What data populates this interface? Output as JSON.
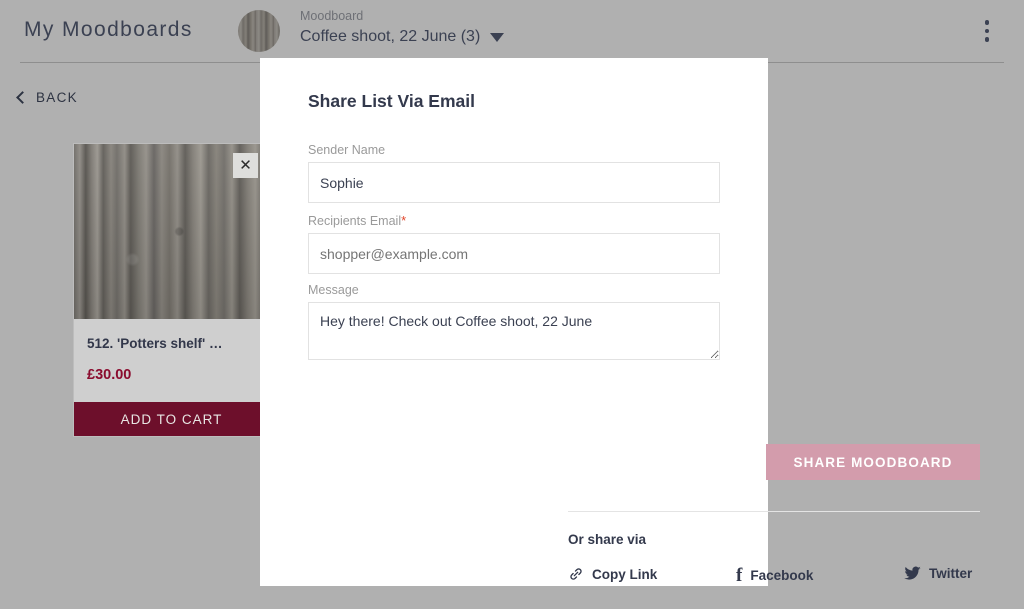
{
  "header": {
    "app_title": "My Moodboards",
    "moodboard_label": "Moodboard",
    "moodboard_name": "Coffee shoot, 22 June (3)",
    "avatar_icon": "moodboard-thumbnail",
    "caret_icon": "chevron-down-icon",
    "menu_icon": "kebab-menu-icon"
  },
  "nav": {
    "back_label": "BACK",
    "back_icon": "chevron-left-icon"
  },
  "card": {
    "title": "512. 'Potters shelf' …",
    "price": "£30.00",
    "cta_label": "ADD TO CART",
    "close_icon": "close-icon",
    "close_glyph": "✕",
    "image_alt": "wooden-planks-texture"
  },
  "modal": {
    "title": "Share List Via Email",
    "fields": {
      "sender": {
        "label": "Sender Name",
        "value": "Sophie",
        "placeholder": "Sender Name",
        "required": false
      },
      "email": {
        "label": "Recipients Email",
        "value": "",
        "placeholder": "shopper@example.com",
        "required": true,
        "required_marker": "*"
      },
      "message": {
        "label": "Message",
        "value": "Hey there! Check out Coffee shoot, 22 June",
        "placeholder": "Message",
        "required": false
      }
    },
    "submit_label": "SHARE MOODBOARD",
    "or_share_label": "Or share via",
    "share_links": [
      {
        "label": "Copy Link",
        "icon": "link-icon"
      },
      {
        "label": "Facebook",
        "icon": "facebook-icon",
        "glyph": "f"
      },
      {
        "label": "Twitter",
        "icon": "twitter-icon"
      }
    ]
  },
  "colors": {
    "page_background": "#b0b0b0",
    "modal_background": "#ffffff",
    "text_dark": "#33394c",
    "label_grey": "#9a9a9a",
    "required_red": "#e2452a",
    "submit_pink": "#d39cac",
    "cta_maroon": "#6d0f2b",
    "price_red": "#8a0b2e",
    "border_grey": "#e2e2e2"
  }
}
